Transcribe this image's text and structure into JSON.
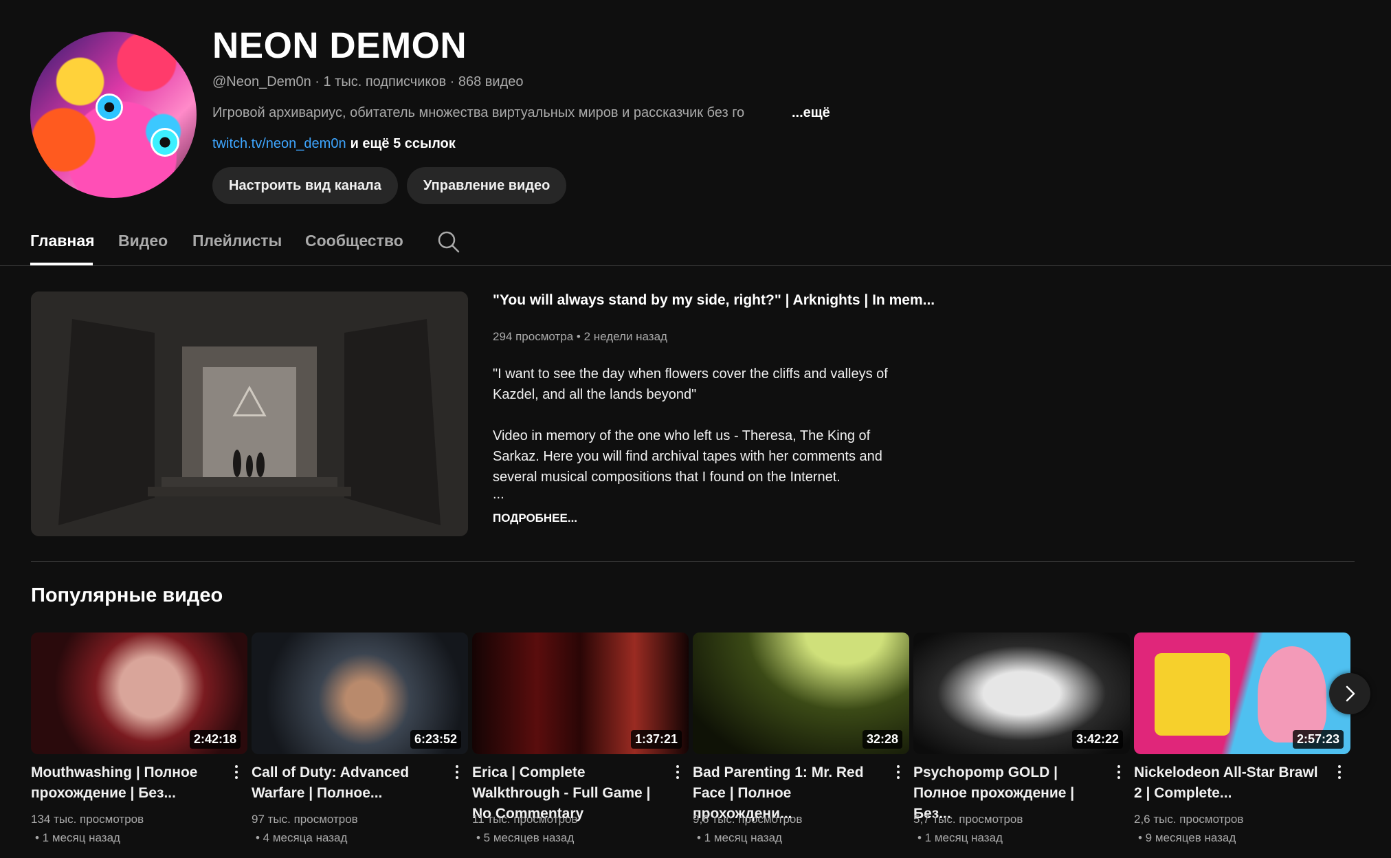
{
  "channel": {
    "name": "NEON DEMON",
    "meta": "@Neon_Dem0n · 1 тыс. подписчиков · 868 видео",
    "description": "Игровой архивариус, обитатель множества виртуальных миров и рассказчик без го",
    "description_more": "...ещё",
    "link_text": "twitch.tv/neon_dem0n",
    "links_more": "и ещё 5 ссылок",
    "customize_button": "Настроить вид канала",
    "manage_button": "Управление видео"
  },
  "tabs": [
    {
      "label": "Главная",
      "active": true
    },
    {
      "label": "Видео",
      "active": false
    },
    {
      "label": "Плейлисты",
      "active": false
    },
    {
      "label": "Сообщество",
      "active": false
    }
  ],
  "featured": {
    "title": "\"You will always stand by my side, right?\" | Arknights | In mem...",
    "meta": "294 просмотра • 2 недели назад",
    "desc_p1": "\"I want to see the day when flowers cover the cliffs and valleys of Kazdel, and all the lands beyond\"",
    "desc_p2": "Video in memory of the one who left us - Theresa, The King of Sarkaz. Here you will find archival tapes with her comments and several musical compositions that I found on the Internet.",
    "desc_ellipsis": "...",
    "more_label": "ПОДРОБНЕЕ..."
  },
  "popular": {
    "title": "Популярные видео",
    "videos": [
      {
        "title": "Mouthwashing | Полное прохождение | Без...",
        "duration": "2:42:18",
        "views": "134 тыс. просмотров",
        "age": "• 1 месяц назад",
        "colors": [
          "#2a0a0c",
          "#7a1b20",
          "#d9a59a"
        ]
      },
      {
        "title": "Call of Duty: Advanced Warfare | Полное...",
        "duration": "6:23:52",
        "views": "97 тыс. просмотров",
        "age": "• 4 месяца назад",
        "colors": [
          "#14171c",
          "#3b4450",
          "#b98a6c"
        ]
      },
      {
        "title": "Erica | Complete Walkthrough - Full Game | No Commentary",
        "duration": "1:37:21",
        "views": "11 тыс. просмотров",
        "age": "• 5 месяцев назад",
        "colors": [
          "#140404",
          "#5a0d0d",
          "#9a2b22"
        ]
      },
      {
        "title": "Bad Parenting 1: Mr. Red Face | Полное прохождени...",
        "duration": "32:28",
        "views": "9,6 тыс. просмотров",
        "age": "• 1 месяц назад",
        "colors": [
          "#0f1206",
          "#3b4a16",
          "#cfe07a"
        ]
      },
      {
        "title": "Psychopomp GOLD | Полное прохождение | Без...",
        "duration": "3:42:22",
        "views": "5,7 тыс. просмотров",
        "age": "• 1 месяц назад",
        "colors": [
          "#0c0c0c",
          "#2a2a2a",
          "#e6e6e6"
        ]
      },
      {
        "title": "Nickelodeon All-Star Brawl 2 | Complete...",
        "duration": "2:57:23",
        "views": "2,6 тыс. просмотров",
        "age": "• 9 месяцев назад",
        "colors": [
          "#e0267a",
          "#f6d02c",
          "#4fc0f0"
        ]
      }
    ]
  },
  "icons": {
    "search": "search-icon",
    "more": "more-vert-icon",
    "next": "chevron-right-icon"
  }
}
